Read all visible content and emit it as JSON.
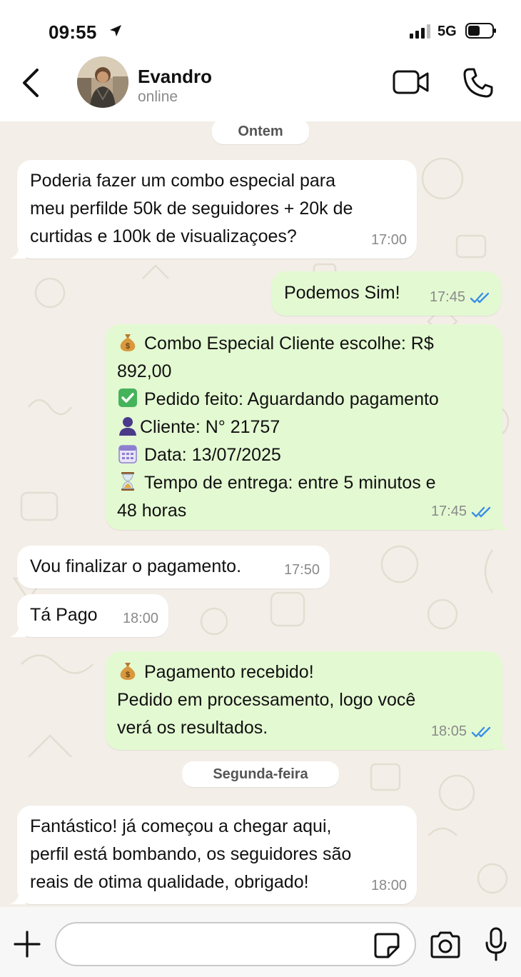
{
  "status_bar": {
    "time": "09:55",
    "network": "5G"
  },
  "header": {
    "contact_name": "Evandro",
    "contact_status": "online"
  },
  "chat": {
    "date_separators": [
      "Ontem",
      "Segunda-feira"
    ],
    "messages": [
      {
        "direction": "incoming",
        "text": "Poderia fazer um combo especial para\nmeu perfilde 50k de seguidores + 20k de\ncurtidas e 100k de visualizaçoes?",
        "time": "17:00"
      },
      {
        "direction": "outgoing",
        "text": "Podemos Sim!",
        "time": "17:45",
        "status": "read"
      },
      {
        "direction": "outgoing",
        "lines": [
          {
            "icon": "money-bag-icon",
            "text": "Combo Especial Cliente escolhe: R$"
          },
          {
            "icon": "",
            "text": "892,00"
          },
          {
            "icon": "check-mark-icon",
            "text": "Pedido feito: Aguardando pagamento"
          },
          {
            "icon": "person-icon",
            "text": "Cliente: N° 21757"
          },
          {
            "icon": "calendar-icon",
            "text": "Data: 13/07/2025"
          },
          {
            "icon": "hourglass-icon",
            "text": "Tempo de entrega: entre 5 minutos e"
          },
          {
            "icon": "",
            "text": "48 horas"
          }
        ],
        "time": "17:45",
        "status": "read"
      },
      {
        "direction": "incoming",
        "text": "Vou finalizar o pagamento.",
        "time": "17:50"
      },
      {
        "direction": "incoming",
        "text": "Tá Pago",
        "time": "18:00"
      },
      {
        "direction": "outgoing",
        "lines": [
          {
            "icon": "money-bag-icon",
            "text": "Pagamento recebido!"
          },
          {
            "icon": "",
            "text": "Pedido em processamento, logo você"
          },
          {
            "icon": "",
            "text": "verá os resultados."
          }
        ],
        "time": "18:05",
        "status": "read"
      },
      {
        "direction": "incoming",
        "text": "Fantástico! já começou a chegar aqui,\nperfil está bombando, os seguidores são\nreais de otima qualidade, obrigado!",
        "time": "18:00"
      }
    ]
  },
  "composer": {
    "value": "",
    "placeholder": ""
  },
  "colors": {
    "incoming_bubble": "#ffffff",
    "outgoing_bubble": "#e3f9d2",
    "read_ticks": "#3a8fe6",
    "wallpaper": "#f3efe8"
  }
}
